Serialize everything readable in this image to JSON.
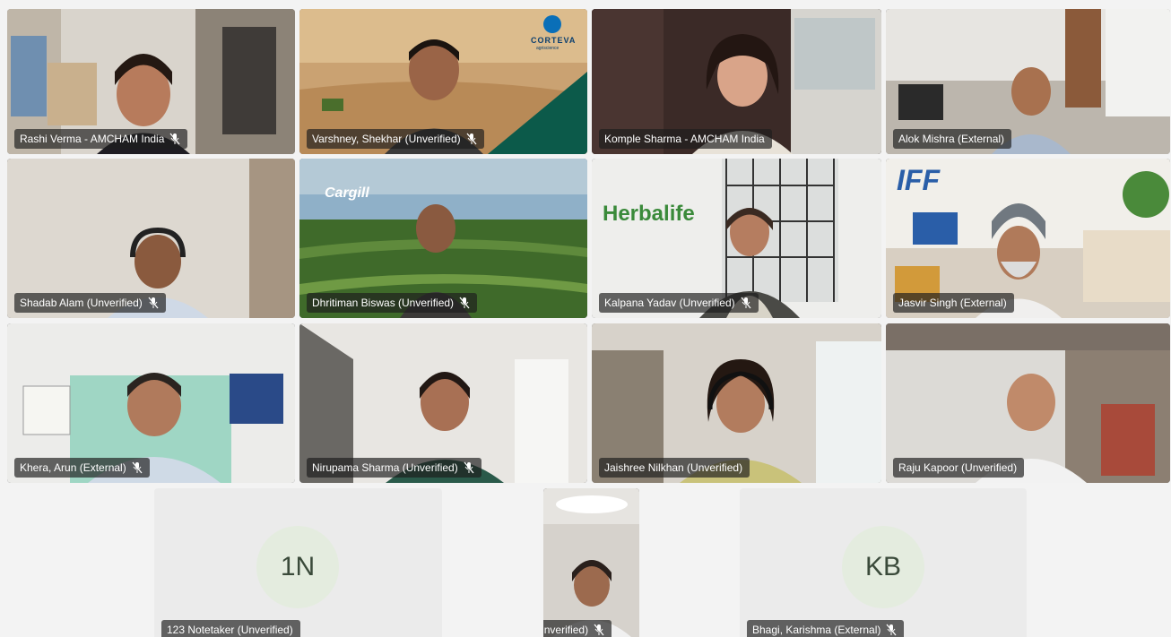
{
  "participants": [
    {
      "name": "Rashi Verma - AMCHAM India",
      "muted": true
    },
    {
      "name": "Varshney, Shekhar (Unverified)",
      "muted": true,
      "logo": "CORTEVA",
      "logo_sub": "agriscience"
    },
    {
      "name": "Komple Sharma - AMCHAM India",
      "muted": false
    },
    {
      "name": "Alok Mishra (External)",
      "muted": false
    },
    {
      "name": "Shadab Alam (Unverified)",
      "muted": true
    },
    {
      "name": "Dhritiman Biswas (Unverified)",
      "muted": true,
      "logo": "Cargill"
    },
    {
      "name": "Kalpana Yadav (Unverified)",
      "muted": true,
      "logo": "Herbalife"
    },
    {
      "name": "Jasvir Singh (External)",
      "muted": false,
      "logo": "IFF"
    },
    {
      "name": "Khera, Arun (External)",
      "muted": true
    },
    {
      "name": "Nirupama Sharma (Unverified)",
      "muted": true
    },
    {
      "name": "Jaishree Nilkhan (Unverified)",
      "muted": false
    },
    {
      "name": "Raju Kapoor (Unverified)",
      "muted": false
    },
    {
      "name": "123 Notetaker (Unverified)",
      "muted": false,
      "initials": "1N"
    },
    {
      "name": "Bhavna Ahooja (Unverified)",
      "muted": true
    },
    {
      "name": "Bhagi, Karishma (External)",
      "muted": true,
      "initials": "KB"
    }
  ],
  "colors": {
    "label_bg": "#1e1e1e",
    "stage_bg": "#f3f3f3",
    "herbalife_green": "#3a8a3a",
    "corteva_blue": "#0a6fb8"
  },
  "icons": {
    "mute": "mic-off-icon"
  }
}
